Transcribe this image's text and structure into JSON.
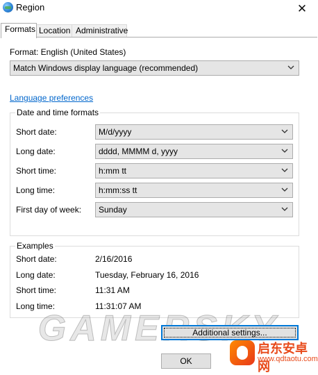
{
  "window": {
    "title": "Region",
    "close_glyph": "✕"
  },
  "tabs": [
    {
      "label": "Formats",
      "active": true
    },
    {
      "label": "Location",
      "active": false
    },
    {
      "label": "Administrative",
      "active": false
    }
  ],
  "format": {
    "label": "Format: English (United States)",
    "selected": "Match Windows display language (recommended)"
  },
  "language_link": "Language preferences",
  "date_time": {
    "title": "Date and time formats",
    "rows": [
      {
        "label": "Short date:",
        "value": "M/d/yyyy"
      },
      {
        "label": "Long date:",
        "value": "dddd, MMMM d, yyyy"
      },
      {
        "label": "Short time:",
        "value": "h:mm tt"
      },
      {
        "label": "Long time:",
        "value": "h:mm:ss tt"
      },
      {
        "label": "First day of week:",
        "value": "Sunday"
      }
    ]
  },
  "examples": {
    "title": "Examples",
    "rows": [
      {
        "label": "Short date:",
        "value": "2/16/2016"
      },
      {
        "label": "Long date:",
        "value": "Tuesday, February 16, 2016"
      },
      {
        "label": "Short time:",
        "value": "11:31 AM"
      },
      {
        "label": "Long time:",
        "value": "11:31:07 AM"
      }
    ]
  },
  "buttons": {
    "additional": "Additional settings...",
    "ok": "OK"
  },
  "watermark": {
    "text": "GAMERSKY",
    "logo_text": "启东安卓网",
    "logo_url": "www.qdtaotu.com"
  },
  "colors": {
    "link": "#0066cc",
    "focus": "#0078d7",
    "dropdown_bg": "#e5e5e5"
  },
  "icons": {
    "app": "region-globe-icon",
    "dropdown": "chevron-down-icon",
    "close": "close-icon"
  }
}
